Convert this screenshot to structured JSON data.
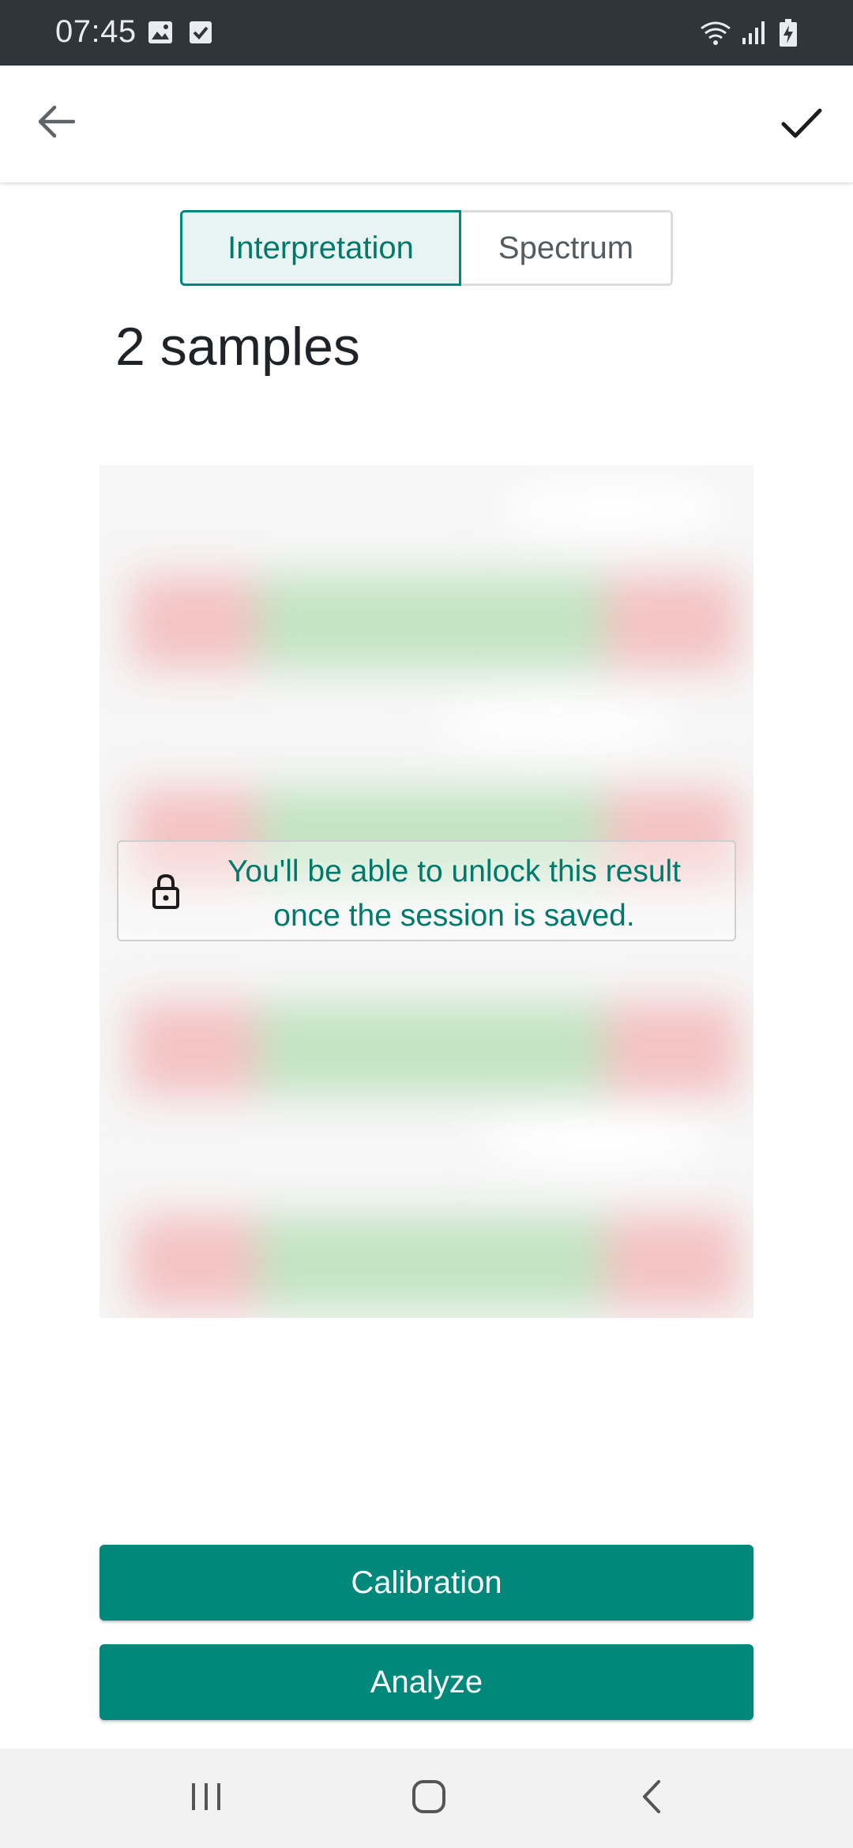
{
  "status_bar": {
    "time": "07:45",
    "icons": [
      "image-icon",
      "checkbox-icon",
      "wifi-icon",
      "signal-icon",
      "battery-charging-icon"
    ]
  },
  "app_bar": {
    "back_icon": "arrow-left-icon",
    "confirm_icon": "check-icon"
  },
  "tabs": [
    {
      "label": "Interpretation",
      "selected": true
    },
    {
      "label": "Spectrum",
      "selected": false
    }
  ],
  "samples_title": "2 samples",
  "locked_result": {
    "icon": "lock-icon",
    "message": "You'll be able to unlock this result once the session is saved."
  },
  "buttons": {
    "calibration": "Calibration",
    "analyze": "Analyze"
  },
  "nav_bar": {
    "icons": [
      "recents-icon",
      "home-icon",
      "back-icon"
    ]
  },
  "colors": {
    "accent": "#00897b",
    "accent_text": "#00796b",
    "tab_active_bg": "#e8f4f2",
    "status_bar_bg": "#30343b",
    "preview_red": "#f4c3c3",
    "preview_green": "#c3e4c3"
  }
}
